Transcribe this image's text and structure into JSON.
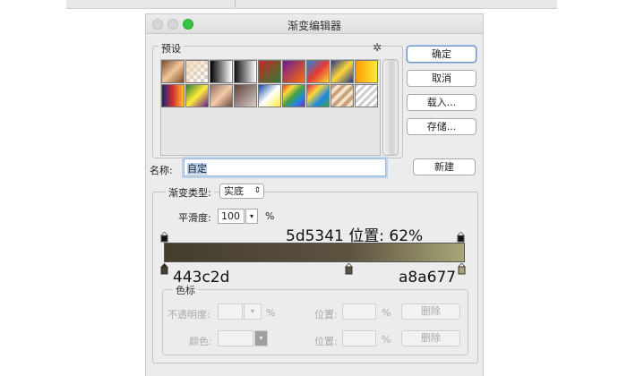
{
  "window": {
    "title": "渐变编辑器"
  },
  "presets": {
    "label": "预设",
    "gear_icon": "gear-icon",
    "swatches_row1": [
      "linear-gradient(135deg,#7a4a2a,#f1c79a,#7a4a2a)",
      "linear-gradient(135deg,#f3d8b8,rgba(255,255,255,0))",
      "linear-gradient(90deg,#000,#fff)",
      "linear-gradient(90deg,#111,#fff)",
      "linear-gradient(135deg,#c62828,#2e7d32)",
      "linear-gradient(135deg,#6a1b9a,#ff6f00)",
      "linear-gradient(135deg,#1e88e5,#e53935,#fdd835)",
      "linear-gradient(135deg,#283593,#fdd835,#283593)",
      "linear-gradient(90deg,#ff9800,#ffeb3b)"
    ],
    "swatches_row2": [
      "linear-gradient(90deg,#1a237e,#d32f2f,#fbc02d)",
      "linear-gradient(135deg,#2e7d32,#ffeb3b,#6a1b9a)",
      "linear-gradient(135deg,#8d6e63,#f5cba7,#6d4c41)",
      "linear-gradient(135deg,#5d4037,#d7ccc8)",
      "linear-gradient(135deg,#0d47a1,#fff,#ffeb3b)",
      "linear-gradient(135deg,#e53935,#fdd835,#43a047,#1e88e5,#8e24aa)",
      "linear-gradient(135deg,#d81b60,#fdd835,#1e88e5,#43a047)",
      "repeating-linear-gradient(135deg,#c8a27a 0 4px,#f3e2c8 4px 8px)",
      "repeating-linear-gradient(135deg,#cfcfcf 0 3px,#ffffff 3px 6px)"
    ]
  },
  "buttons": {
    "ok": "确定",
    "cancel": "取消",
    "load": "载入...",
    "save": "存储...",
    "new": "新建"
  },
  "name": {
    "label": "名称:",
    "value": "自定"
  },
  "gradient": {
    "type_label": "渐变类型:",
    "type_value": "实底",
    "smoothness_label": "平滑度:",
    "smoothness_value": "100",
    "smoothness_unit": "%",
    "stops": {
      "left_color": "#443c2d",
      "mid_color": "#5d5341",
      "right_color": "#a8a677",
      "mid_location_pct": 62
    }
  },
  "annotations": {
    "top": "5d5341 位置: 62%",
    "left": "443c2d",
    "right": "a8a677"
  },
  "color_stops": {
    "label": "色标",
    "opacity_label": "不透明度:",
    "opacity_unit": "%",
    "location_label": "位置:",
    "location_unit": "%",
    "delete_label": "删除",
    "color_label": "颜色:"
  }
}
